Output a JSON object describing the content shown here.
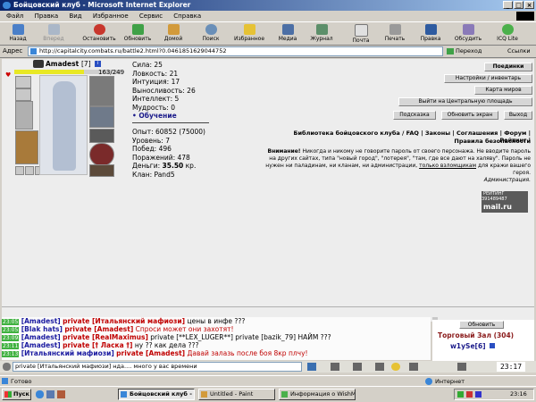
{
  "window": {
    "title": "Бойцовский клуб - Microsoft Internet Explorer"
  },
  "menu": [
    "Файл",
    "Правка",
    "Вид",
    "Избранное",
    "Сервис",
    "Справка"
  ],
  "toolbar": {
    "back": "Назад",
    "forward": "Вперед",
    "stop": "Остановить",
    "refresh": "Обновить",
    "home": "Домой",
    "search": "Поиск",
    "favorites": "Избранное",
    "media": "Медиа",
    "history": "Журнал",
    "mail": "Почта",
    "print": "Печать",
    "edit": "Правка",
    "discuss": "Обсудить",
    "icq": "ICQ Lite"
  },
  "address": {
    "label": "Адрес",
    "url": "http://capitalcity.combats.ru/battle2.html?0.0461851629044752",
    "go": "Переход",
    "links": "Ссылки"
  },
  "character": {
    "name": "Amadest",
    "level": "[7]",
    "hp": "163/249",
    "stats": [
      "Сила: 25",
      "Ловкость: 21",
      "Интуиция: 17",
      "Выносливость: 26",
      "Интеллект: 5",
      "Мудрость: 0"
    ],
    "training": "• Обучение",
    "exp": "Опыт: 60852 (75000)",
    "level_line": "Уровень: 7",
    "wins": "Побед: 496",
    "losses": "Поражений: 478",
    "money_label": "Деньги:",
    "money_value": "35.50",
    "money_unit": "кр.",
    "clan": "Клан: Pand5"
  },
  "right_buttons": {
    "fights": "Поединки",
    "settings": "Настройки / инвентарь",
    "map": "Карта миров",
    "exit_square": "Выйти на Центральную площадь",
    "hint": "Подсказка",
    "refresh": "Обновить экран",
    "logout": "Выход"
  },
  "links_line1": [
    "Библиотека бойцовского клуба",
    "FAQ",
    "Законы",
    "Соглашения",
    "Форум",
    "Рейтинг"
  ],
  "links_line2": "Правила безопасности",
  "notice": {
    "title": "Внимание!",
    "text": "Никогда и никому не говорите пароль от своего персонажа. Не вводите пароль на других сайтах, типа \"новый город\", \"лотерея\", \"там, где все дают на халяву\". Пароль не нужен ни паладинам, ни кланам, ни администрации,",
    "underlined": "только взломщикам",
    "tail": "для кражи вашего героя.",
    "sign": "Администрация."
  },
  "rating": {
    "label": "РЕЙТИНГ",
    "code": "391489487",
    "brand": "mail.ru"
  },
  "chat": [
    {
      "time": "23:05",
      "nick": "[Amadest]",
      "priv": "private [Итальянский мафиози]",
      "text": "цены в инфе ???"
    },
    {
      "time": "23:05",
      "nick": "[Blak hats]",
      "priv": "private [Amadest]",
      "text": "Спроси может они захотят!"
    },
    {
      "time": "23:09",
      "nick": "[Amadest]",
      "priv": "private [RealMaximus]",
      "text": "private [**LEX_LUGER**] private [bazik_79] НАЙМ ???"
    },
    {
      "time": "23:11",
      "nick": "[Amadest]",
      "priv": "private [† Ласка †]",
      "text": "ну ?? как дела ???"
    },
    {
      "time": "23:13",
      "nick": "[Итальянский мафиози]",
      "priv": "private [Amadest]",
      "text": "Давай залазь после боя 8кр плчу!"
    }
  ],
  "side": {
    "refresh": "Обновить",
    "hall": "Торговый Зал (304)",
    "user": "w1ySe[6]"
  },
  "input": {
    "value": "private [Итальянский мафиози] нда.... много у вас времени"
  },
  "clock_small": "23:17",
  "status": {
    "left": "Готово",
    "right": "Интернет"
  },
  "taskbar": {
    "start": "Пуск",
    "t1": "Бойцовский клуб - ...",
    "t2": "Untitled - Paint",
    "t3": "Информация о WishMast...",
    "time": "23:16"
  }
}
